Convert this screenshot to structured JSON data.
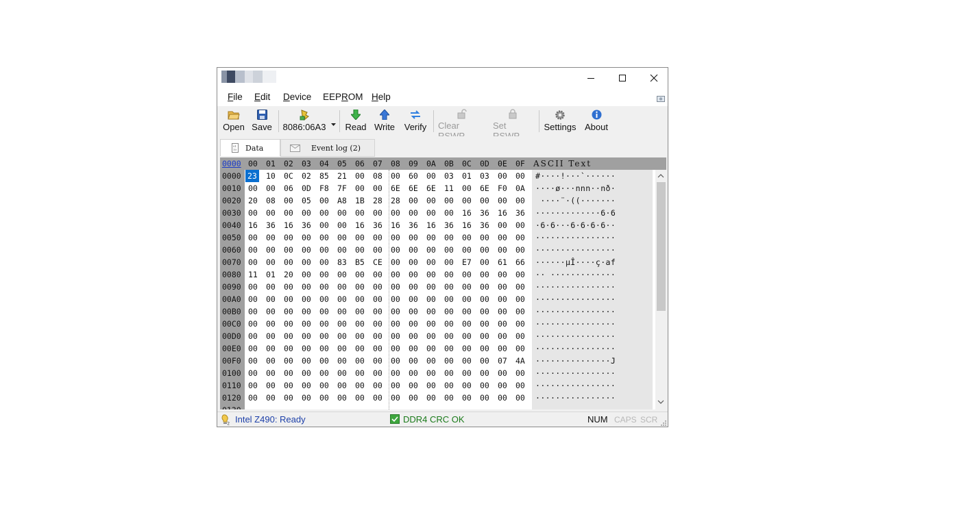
{
  "menu": [
    {
      "label": "File",
      "u": "F",
      "rest": "ile"
    },
    {
      "label": "Edit",
      "u": "E",
      "rest": "dit"
    },
    {
      "label": "Device",
      "u": "D",
      "rest": "evice"
    },
    {
      "label": "EEPROM",
      "pre": "EEP",
      "u": "R",
      "rest": "OM"
    },
    {
      "label": "Help",
      "u": "H",
      "rest": "elp"
    }
  ],
  "toolbar": {
    "open": "Open",
    "save": "Save",
    "device": "8086:06A3",
    "read": "Read",
    "write": "Write",
    "verify": "Verify",
    "clear_rswp": "Clear RSWP",
    "set_rswp": "Set RSWP",
    "settings": "Settings",
    "about": "About"
  },
  "tabs": {
    "data": "Data",
    "event_log": "Event log (2)"
  },
  "hex": {
    "corner": "0000",
    "columns": [
      "00",
      "01",
      "02",
      "03",
      "04",
      "05",
      "06",
      "07",
      "08",
      "09",
      "0A",
      "0B",
      "0C",
      "0D",
      "0E",
      "0F"
    ],
    "ascii_header": "ASCII Text",
    "selected": {
      "row": 0,
      "col": 0
    },
    "rows": [
      {
        "addr": "0000",
        "bytes": [
          "23",
          "10",
          "0C",
          "02",
          "85",
          "21",
          "00",
          "08",
          "00",
          "60",
          "00",
          "03",
          "01",
          "03",
          "00",
          "00"
        ],
        "ascii": "#····!···`······"
      },
      {
        "addr": "0010",
        "bytes": [
          "00",
          "00",
          "06",
          "0D",
          "F8",
          "7F",
          "00",
          "00",
          "6E",
          "6E",
          "6E",
          "11",
          "00",
          "6E",
          "F0",
          "0A"
        ],
        "ascii": "····ø···nnn··nð·"
      },
      {
        "addr": "0020",
        "bytes": [
          "20",
          "08",
          "00",
          "05",
          "00",
          "A8",
          "1B",
          "28",
          "28",
          "00",
          "00",
          "00",
          "00",
          "00",
          "00",
          "00"
        ],
        "ascii": " ····¨·((·······"
      },
      {
        "addr": "0030",
        "bytes": [
          "00",
          "00",
          "00",
          "00",
          "00",
          "00",
          "00",
          "00",
          "00",
          "00",
          "00",
          "00",
          "16",
          "36",
          "16",
          "36"
        ],
        "ascii": "·············6·6"
      },
      {
        "addr": "0040",
        "bytes": [
          "16",
          "36",
          "16",
          "36",
          "00",
          "00",
          "16",
          "36",
          "16",
          "36",
          "16",
          "36",
          "16",
          "36",
          "00",
          "00"
        ],
        "ascii": "·6·6···6·6·6·6··"
      },
      {
        "addr": "0050",
        "bytes": [
          "00",
          "00",
          "00",
          "00",
          "00",
          "00",
          "00",
          "00",
          "00",
          "00",
          "00",
          "00",
          "00",
          "00",
          "00",
          "00"
        ],
        "ascii": "················"
      },
      {
        "addr": "0060",
        "bytes": [
          "00",
          "00",
          "00",
          "00",
          "00",
          "00",
          "00",
          "00",
          "00",
          "00",
          "00",
          "00",
          "00",
          "00",
          "00",
          "00"
        ],
        "ascii": "················"
      },
      {
        "addr": "0070",
        "bytes": [
          "00",
          "00",
          "00",
          "00",
          "00",
          "83",
          "B5",
          "CE",
          "00",
          "00",
          "00",
          "00",
          "E7",
          "00",
          "61",
          "66"
        ],
        "ascii": "······µÎ····ç·af"
      },
      {
        "addr": "0080",
        "bytes": [
          "11",
          "01",
          "20",
          "00",
          "00",
          "00",
          "00",
          "00",
          "00",
          "00",
          "00",
          "00",
          "00",
          "00",
          "00",
          "00"
        ],
        "ascii": "·· ·············"
      },
      {
        "addr": "0090",
        "bytes": [
          "00",
          "00",
          "00",
          "00",
          "00",
          "00",
          "00",
          "00",
          "00",
          "00",
          "00",
          "00",
          "00",
          "00",
          "00",
          "00"
        ],
        "ascii": "················"
      },
      {
        "addr": "00A0",
        "bytes": [
          "00",
          "00",
          "00",
          "00",
          "00",
          "00",
          "00",
          "00",
          "00",
          "00",
          "00",
          "00",
          "00",
          "00",
          "00",
          "00"
        ],
        "ascii": "················"
      },
      {
        "addr": "00B0",
        "bytes": [
          "00",
          "00",
          "00",
          "00",
          "00",
          "00",
          "00",
          "00",
          "00",
          "00",
          "00",
          "00",
          "00",
          "00",
          "00",
          "00"
        ],
        "ascii": "················"
      },
      {
        "addr": "00C0",
        "bytes": [
          "00",
          "00",
          "00",
          "00",
          "00",
          "00",
          "00",
          "00",
          "00",
          "00",
          "00",
          "00",
          "00",
          "00",
          "00",
          "00"
        ],
        "ascii": "················"
      },
      {
        "addr": "00D0",
        "bytes": [
          "00",
          "00",
          "00",
          "00",
          "00",
          "00",
          "00",
          "00",
          "00",
          "00",
          "00",
          "00",
          "00",
          "00",
          "00",
          "00"
        ],
        "ascii": "················"
      },
      {
        "addr": "00E0",
        "bytes": [
          "00",
          "00",
          "00",
          "00",
          "00",
          "00",
          "00",
          "00",
          "00",
          "00",
          "00",
          "00",
          "00",
          "00",
          "00",
          "00"
        ],
        "ascii": "················"
      },
      {
        "addr": "00F0",
        "bytes": [
          "00",
          "00",
          "00",
          "00",
          "00",
          "00",
          "00",
          "00",
          "00",
          "00",
          "00",
          "00",
          "00",
          "00",
          "07",
          "4A"
        ],
        "ascii": "···············J"
      },
      {
        "addr": "0100",
        "bytes": [
          "00",
          "00",
          "00",
          "00",
          "00",
          "00",
          "00",
          "00",
          "00",
          "00",
          "00",
          "00",
          "00",
          "00",
          "00",
          "00"
        ],
        "ascii": "················"
      },
      {
        "addr": "0110",
        "bytes": [
          "00",
          "00",
          "00",
          "00",
          "00",
          "00",
          "00",
          "00",
          "00",
          "00",
          "00",
          "00",
          "00",
          "00",
          "00",
          "00"
        ],
        "ascii": "················"
      },
      {
        "addr": "0120",
        "bytes": [
          "00",
          "00",
          "00",
          "00",
          "00",
          "00",
          "00",
          "00",
          "00",
          "00",
          "00",
          "00",
          "00",
          "00",
          "00",
          "00"
        ],
        "ascii": "················"
      }
    ]
  },
  "status": {
    "platform": "Intel Z490: Ready",
    "crc": "DDR4 CRC OK",
    "num": "NUM",
    "caps": "CAPS",
    "scr": "SCR"
  },
  "colors": {
    "selection": "#0a6fd0",
    "platform_text": "#1c3fa8",
    "crc_text": "#1a7a1a",
    "gutter": "#a0a0a0"
  }
}
